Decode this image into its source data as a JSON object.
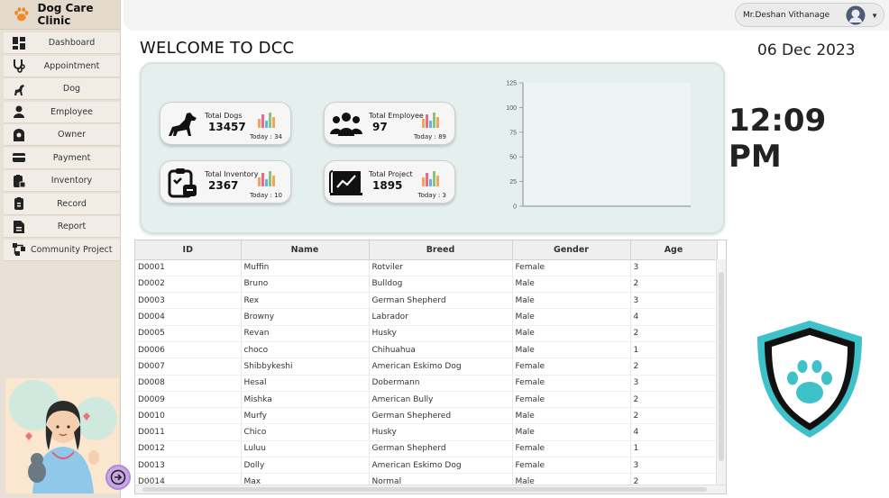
{
  "app": {
    "title": "Dog Care Clinic"
  },
  "sidebar": {
    "items": [
      {
        "label": "Dashboard",
        "icon": "dashboard-icon"
      },
      {
        "label": "Appointment",
        "icon": "stethoscope-icon"
      },
      {
        "label": "Dog",
        "icon": "dog-icon"
      },
      {
        "label": "Employee",
        "icon": "employee-icon"
      },
      {
        "label": "Owner",
        "icon": "owner-icon"
      },
      {
        "label": "Payment",
        "icon": "payment-card-icon"
      },
      {
        "label": "Inventory",
        "icon": "inventory-icon"
      },
      {
        "label": "Record",
        "icon": "record-icon"
      },
      {
        "label": "Report",
        "icon": "report-icon"
      },
      {
        "label": "Community Project",
        "icon": "community-project-icon"
      }
    ]
  },
  "header": {
    "user_name": "Mr.Deshan Vithanage"
  },
  "welcome": "WELCOME TO DCC",
  "date": "06 Dec 2023",
  "time": "12:09 PM",
  "stats": [
    {
      "label": "Total Dogs",
      "value": "13457",
      "today": "Today : 34",
      "icon": "dog-icon"
    },
    {
      "label": "Total Employee",
      "value": "97",
      "today": "Today : 89",
      "icon": "group-icon"
    },
    {
      "label": "Total Inventory",
      "value": "2367",
      "today": "Today : 10",
      "icon": "inventory-clipboard-icon"
    },
    {
      "label": "Total Project",
      "value": "1895",
      "today": "Today : 3",
      "icon": "project-chart-icon"
    }
  ],
  "chart_data": {
    "type": "bar",
    "categories": [],
    "values": [],
    "title": "",
    "xlabel": "",
    "ylabel": "",
    "ylim": [
      0,
      125
    ],
    "yticks": [
      "0",
      "25",
      "50",
      "75",
      "100",
      "125"
    ],
    "grid": false
  },
  "table": {
    "columns": [
      "ID",
      "Name",
      "Breed",
      "Gender",
      "Age"
    ],
    "rows": [
      [
        "D0001",
        "Muffin",
        "Rotviler",
        "Female",
        "3"
      ],
      [
        "D0002",
        "Bruno",
        "Bulldog",
        "Male",
        "2"
      ],
      [
        "D0003",
        "Rex",
        "German Shepherd",
        "Male",
        "3"
      ],
      [
        "D0004",
        "Browny",
        "Labrador",
        "Male",
        "4"
      ],
      [
        "D0005",
        "Revan",
        "Husky",
        "Male",
        "2"
      ],
      [
        "D0006",
        "choco",
        "Chihuahua",
        "Male",
        "1"
      ],
      [
        "D0007",
        "Shibbykeshi",
        "American Eskimo Dog",
        "Female",
        "2"
      ],
      [
        "D0008",
        "Hesal",
        "Dobermann",
        "Female",
        "3"
      ],
      [
        "D0009",
        "Mishka",
        "American Bully",
        "Female",
        "2"
      ],
      [
        "D0010",
        "Murfy",
        "German Shephered",
        "Male",
        "2"
      ],
      [
        "D0011",
        "Chico",
        "Husky",
        "Male",
        "4"
      ],
      [
        "D0012",
        "Luluu",
        "German Shepherd",
        "Female",
        "1"
      ],
      [
        "D0013",
        "Dolly",
        "American Eskimo Dog",
        "Female",
        "3"
      ],
      [
        "D0014",
        "Max",
        "Normal",
        "Male",
        "2"
      ]
    ]
  },
  "colors": {
    "accent_teal": "#3fc1c9",
    "panel_bg": "#e4efee",
    "sidebar_bg": "#e8e0d4"
  }
}
